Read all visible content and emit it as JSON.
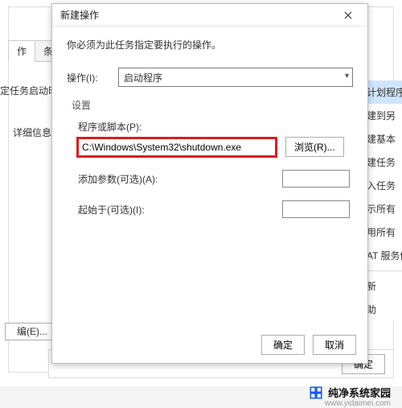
{
  "bg": {
    "tab1": "作",
    "tab2": "条件",
    "label1": "定任务启动时",
    "left_label": "详细信息",
    "edit_btn": "编(E)...",
    "ok": "确定",
    "right": {
      "r0": "计划程序",
      "r1": "建到另",
      "r2": "建基本",
      "r3": "建任务",
      "r4": "入任务",
      "r5": "示所有",
      "r6": "用所有",
      "r7": "AT 服务例",
      "r8": "新",
      "r9": "助"
    }
  },
  "dlg": {
    "title": "新建操作",
    "instr": "你必须为此任务指定要执行的操作。",
    "action_label": "操作(I):",
    "action_value": "启动程序",
    "settings": "设置",
    "program_label": "程序或脚本(P):",
    "program_value": "C:\\Windows\\System32\\shutdown.exe",
    "browse": "浏览(R)...",
    "args_label": "添加参数(可选)(A):",
    "args_value": "",
    "startin_label": "起始于(可选)(I):",
    "startin_value": "",
    "ok": "确定",
    "cancel": "取消"
  },
  "wm": {
    "name": "纯净系统家园",
    "url": "www.yidaimei.com"
  }
}
